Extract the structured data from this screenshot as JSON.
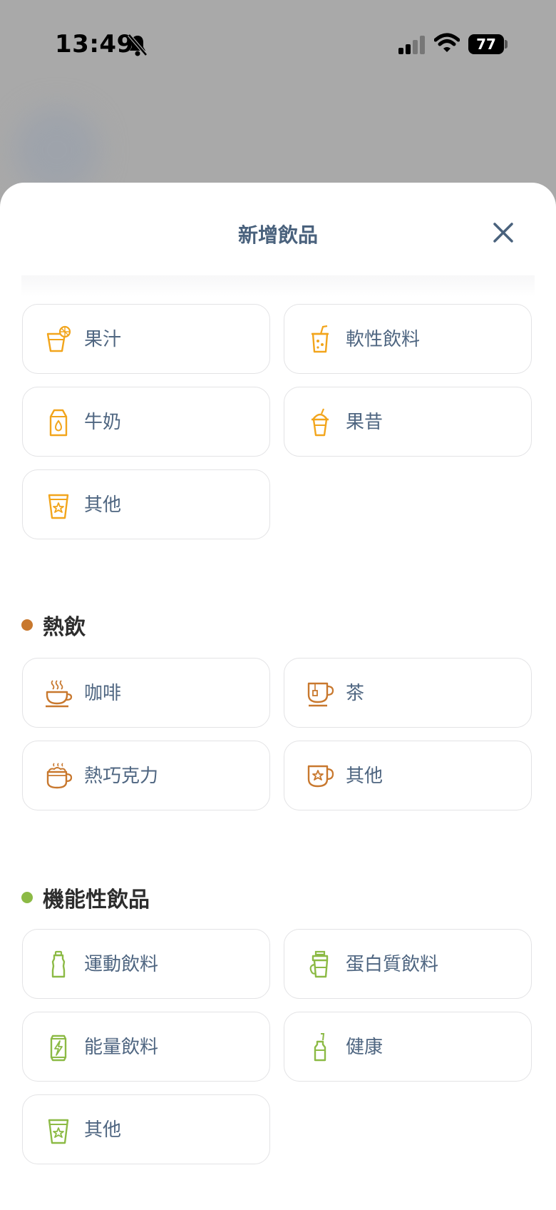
{
  "status": {
    "time": "13:49",
    "battery": "77"
  },
  "sheet": {
    "title": "新增飲品"
  },
  "colors": {
    "cold": "#f2a51c",
    "hot": "#c8782e",
    "functional": "#8cba45"
  },
  "cold_items": [
    {
      "label": "果汁",
      "icon": "juice-icon"
    },
    {
      "label": "軟性飲料",
      "icon": "soda-icon"
    },
    {
      "label": "牛奶",
      "icon": "milk-carton-icon"
    },
    {
      "label": "果昔",
      "icon": "smoothie-icon"
    },
    {
      "label": "其他",
      "icon": "star-cup-icon"
    }
  ],
  "hot_section": {
    "title": "熱飲"
  },
  "hot_items": [
    {
      "label": "咖啡",
      "icon": "coffee-icon"
    },
    {
      "label": "茶",
      "icon": "tea-icon"
    },
    {
      "label": "熱巧克力",
      "icon": "hot-chocolate-icon"
    },
    {
      "label": "其他",
      "icon": "star-mug-icon"
    }
  ],
  "functional_section": {
    "title": "機能性飲品"
  },
  "functional_items": [
    {
      "label": "運動飲料",
      "icon": "sports-bottle-icon"
    },
    {
      "label": "蛋白質飲料",
      "icon": "protein-shaker-icon"
    },
    {
      "label": "能量飲料",
      "icon": "energy-can-icon"
    },
    {
      "label": "健康",
      "icon": "health-bottle-icon"
    },
    {
      "label": "其他",
      "icon": "star-cup-icon"
    }
  ]
}
